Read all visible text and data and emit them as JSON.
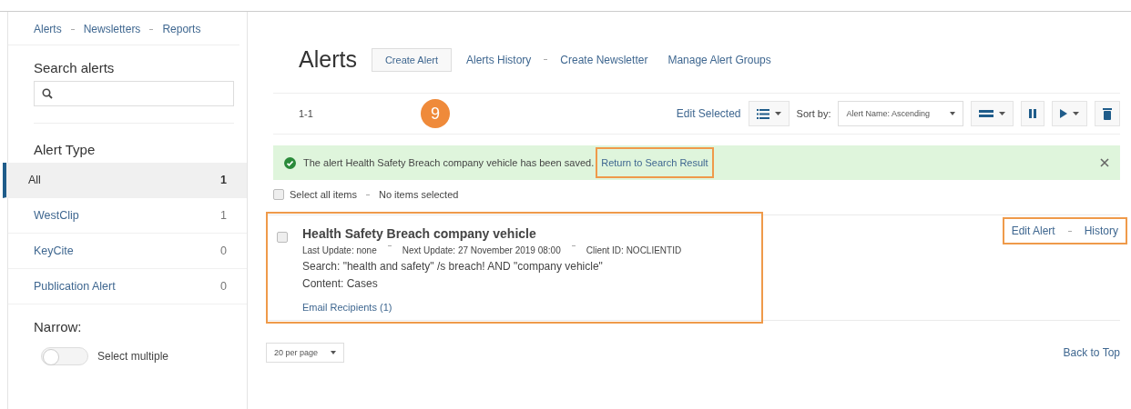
{
  "sidebar": {
    "nav": [
      "Alerts",
      "Newsletters",
      "Reports"
    ],
    "search": {
      "label": "Search alerts"
    },
    "alert_type": {
      "heading": "Alert Type",
      "items": [
        {
          "label": "All",
          "count": "1",
          "selected": true
        },
        {
          "label": "WestClip",
          "count": "1",
          "selected": false
        },
        {
          "label": "KeyCite",
          "count": "0",
          "selected": false
        },
        {
          "label": "Publication Alert",
          "count": "0",
          "selected": false
        }
      ]
    },
    "narrow": {
      "heading": "Narrow:",
      "toggle": {
        "label": "Select multiple",
        "on": false
      }
    }
  },
  "main": {
    "title": "Alerts",
    "create_button": "Create Alert",
    "links": [
      "Alerts History",
      "Create Newsletter",
      "Manage Alert Groups"
    ],
    "step_badge": "9",
    "toolbar": {
      "range": "1-1",
      "edit_selected": "Edit Selected",
      "sort_label": "Sort by:",
      "sort_value": "Alert Name: Ascending"
    },
    "notice": {
      "message": "The alert Health Safety Breach company vehicle has been saved.",
      "link": "Return to Search Result",
      "link_highlighted": true
    },
    "select_all": {
      "label": "Select all items",
      "checked": false
    },
    "selection_status": "No items selected",
    "alerts": [
      {
        "title": "Health Safety Breach company vehicle",
        "checked": false,
        "highlighted": true,
        "meta": [
          "Last Update: none",
          "Next Update: 27 November 2019 08:00",
          "Client ID: NOCLIENTID"
        ],
        "search": "Search: \"health and safety\" /s breach! AND \"company vehicle\"",
        "content": "Content: Cases",
        "recipients": "Email Recipients (1)",
        "actions": [
          "Edit Alert",
          "History"
        ],
        "actions_highlighted": true
      }
    ],
    "per_page": "20 per page",
    "back_to_top": "Back to Top"
  }
}
